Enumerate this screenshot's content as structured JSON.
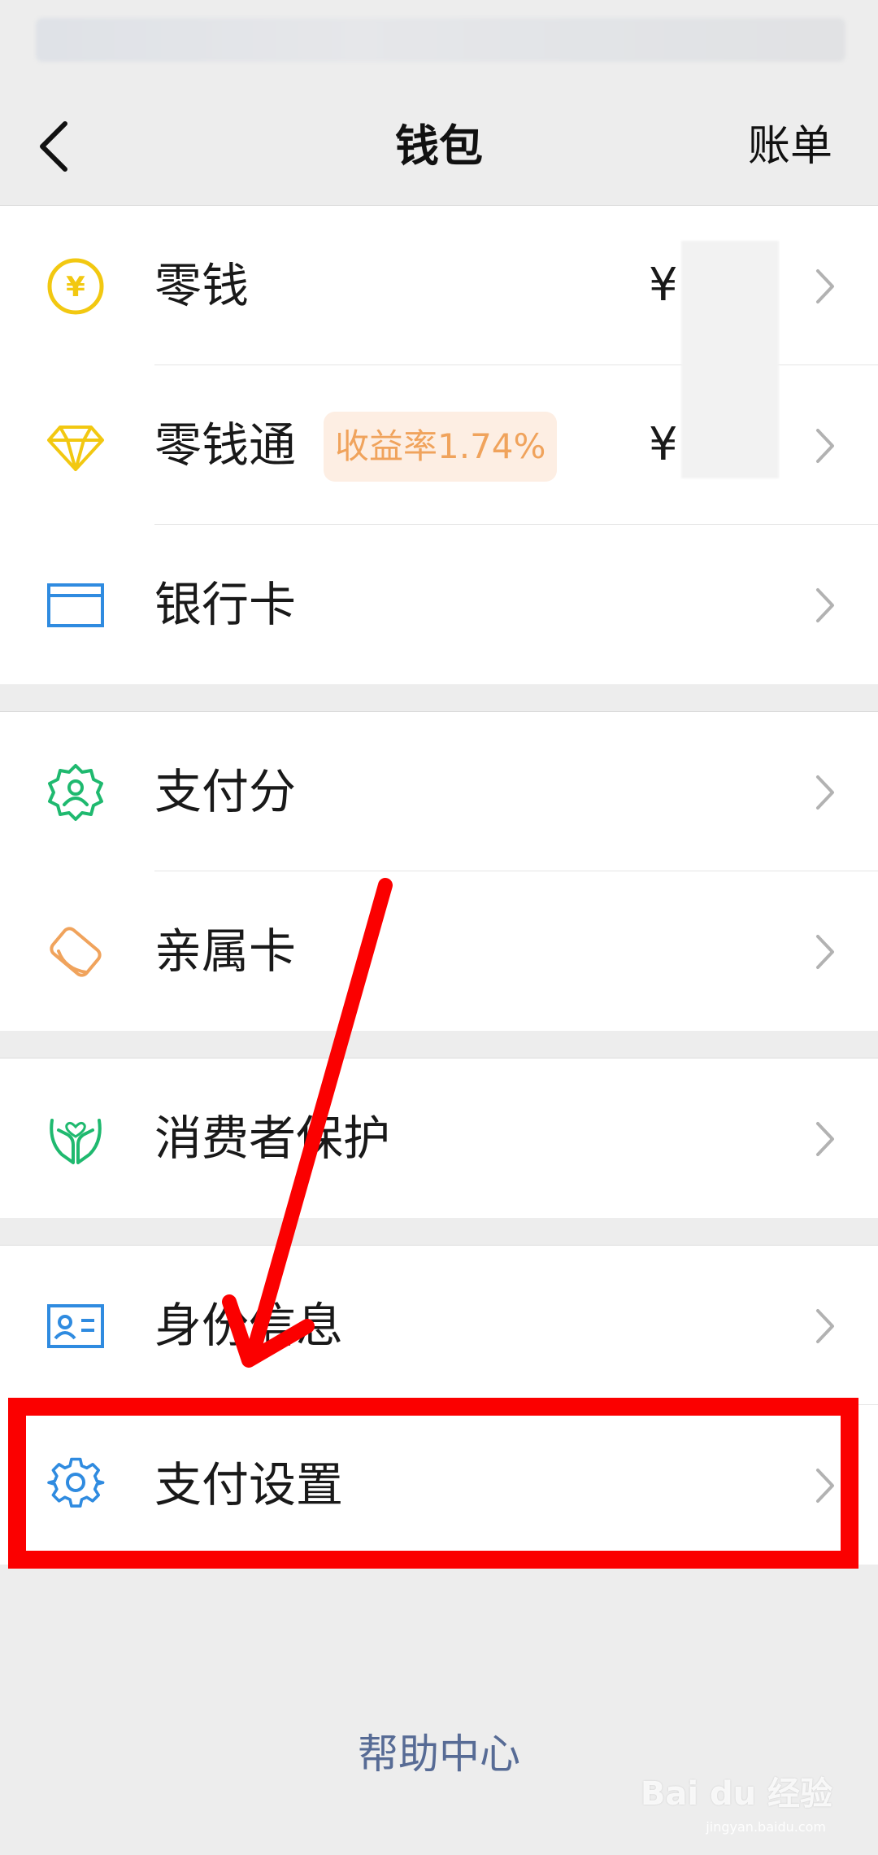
{
  "nav": {
    "title": "钱包",
    "right_action": "账单"
  },
  "groups": [
    {
      "items": [
        {
          "label": "零钱",
          "amount_prefix": "¥",
          "icon": "yuan-coin-icon",
          "color": "#f2c811"
        },
        {
          "label": "零钱通",
          "badge": "收益率1.74%",
          "amount_prefix": "¥",
          "icon": "diamond-icon",
          "color": "#f2c811"
        },
        {
          "label": "银行卡",
          "icon": "bank-card-icon",
          "color": "#2f8be0"
        }
      ]
    },
    {
      "items": [
        {
          "label": "支付分",
          "icon": "pay-score-icon",
          "color": "#1fb96f"
        },
        {
          "label": "亲属卡",
          "icon": "family-card-icon",
          "color": "#f0a35c"
        }
      ]
    },
    {
      "items": [
        {
          "label": "消费者保护",
          "icon": "hands-icon",
          "color": "#1fb96f"
        }
      ]
    },
    {
      "items": [
        {
          "label": "身份信息",
          "icon": "id-card-icon",
          "color": "#2f8be0"
        },
        {
          "label": "支付设置",
          "icon": "gear-icon",
          "color": "#2f8be0"
        }
      ]
    }
  ],
  "footer": {
    "help_link": "帮助中心"
  },
  "watermark": {
    "brand": "Bai du 经验",
    "url": "jingyan.baidu.com"
  },
  "colors": {
    "annotation": "#fb0000",
    "link": "#576b95"
  }
}
